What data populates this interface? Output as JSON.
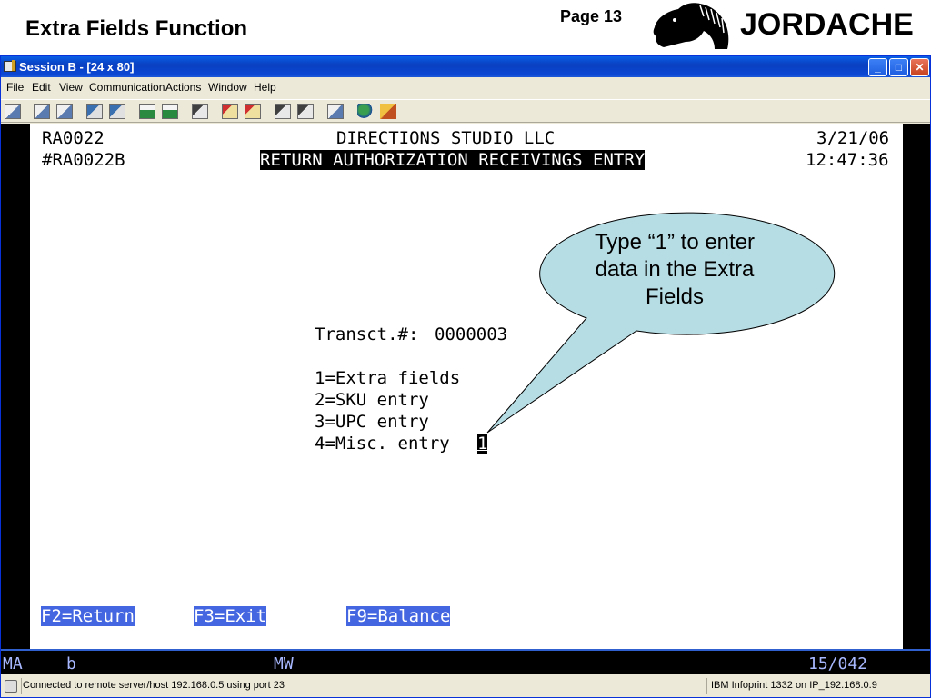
{
  "slide": {
    "title": "Extra Fields Function",
    "page": "Page 13",
    "logo_text": "JORDACHE"
  },
  "window": {
    "title": "Session B - [24 x 80]",
    "controls": {
      "minimize": "_",
      "maximize": "□",
      "close": "✕"
    }
  },
  "menu": [
    "File",
    "Edit",
    "View",
    "Communication",
    "Actions",
    "Window",
    "Help"
  ],
  "toolbar_icons": [
    "screen-icon",
    "copy-icon",
    "paste-icon",
    "send-icon",
    "receive-icon",
    "macro-icon",
    "keypad-icon",
    "print-icon",
    "record-icon",
    "play-icon",
    "transfer-icon",
    "send-file-icon",
    "clipboard-icon",
    "globe-icon",
    "tag-icon"
  ],
  "terminal": {
    "program": "RA0022",
    "company": "DIRECTIONS STUDIO LLC",
    "date": "3/21/06",
    "screen_id": "#RA0022B",
    "screen_title": "RETURN AUTHORIZATION RECEIVINGS ENTRY",
    "time": "12:47:36",
    "transaction_label": "Transct.#:",
    "transaction_value": "0000003",
    "options": [
      "1=Extra fields",
      "2=SKU entry",
      "3=UPC entry",
      "4=Misc. entry"
    ],
    "selection": "1",
    "fkeys": [
      "F2=Return",
      "F3=Exit",
      "F9=Balance"
    ]
  },
  "callout": {
    "text_line1": "Type “1” to enter",
    "text_line2": "data in the Extra",
    "text_line3": "Fields",
    "fill": "#b7dde4"
  },
  "oia": {
    "mode": "MA",
    "b": "b",
    "mw": "MW",
    "cursor_pos": "15/042"
  },
  "status": {
    "connection": "Connected to remote server/host 192.168.0.5 using port 23",
    "printer": "IBM Infoprint 1332 on IP_192.168.0.9"
  }
}
